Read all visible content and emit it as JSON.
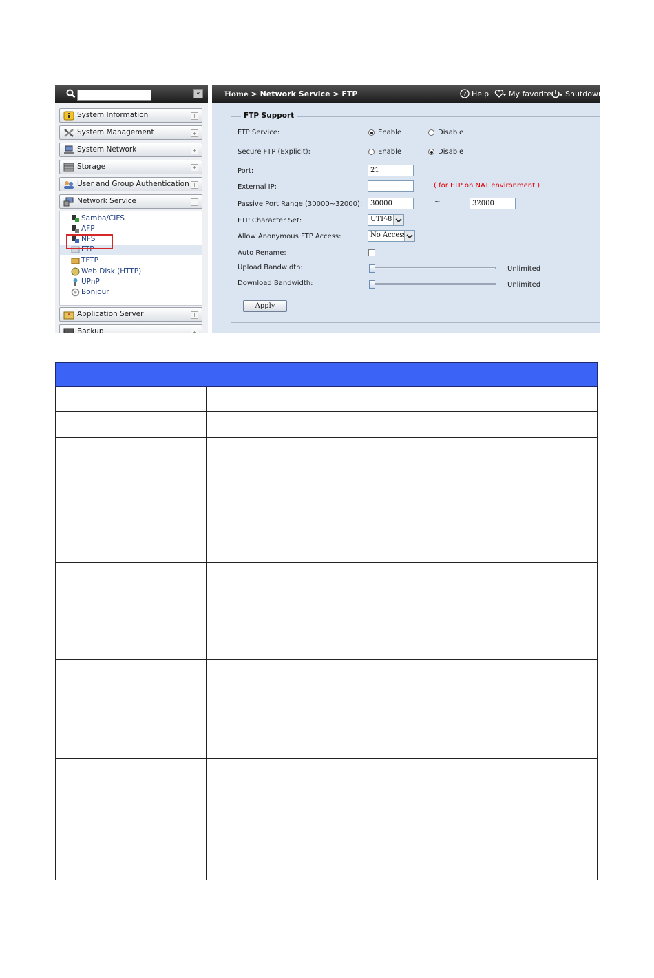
{
  "sidebar": {
    "search_placeholder": "",
    "collapse_symbol": "«",
    "categories": [
      {
        "label": "System Information"
      },
      {
        "label": "System Management"
      },
      {
        "label": "System Network"
      },
      {
        "label": "Storage"
      },
      {
        "label": "User and Group Authentication"
      },
      {
        "label": "Network Service"
      },
      {
        "label": "Application Server"
      },
      {
        "label": "Backup"
      }
    ],
    "network_items": [
      {
        "label": "Samba/CIFS"
      },
      {
        "label": "AFP"
      },
      {
        "label": "NFS"
      },
      {
        "label": "FTP"
      },
      {
        "label": "TFTP"
      },
      {
        "label": "Web Disk (HTTP)"
      },
      {
        "label": "UPnP"
      },
      {
        "label": "Bonjour"
      }
    ],
    "toggle_symbol": "+",
    "toggle_open_symbol": "−"
  },
  "topbar": {
    "crumb_home": "Home",
    "crumb_rest": " > Network Service > FTP",
    "help": "Help",
    "favorite": "My favorite",
    "shutdown": "Shutdown"
  },
  "form": {
    "legend": "FTP Support",
    "ftp_service": {
      "label": "FTP Service:",
      "enable": "Enable",
      "disable": "Disable",
      "selected": "enable"
    },
    "secure_ftp": {
      "label": "Secure FTP (Explicit):",
      "enable": "Enable",
      "disable": "Disable",
      "selected": "disable"
    },
    "port": {
      "label": "Port:",
      "value": "21"
    },
    "external_ip": {
      "label": "External IP:",
      "value": "",
      "hint": "( for FTP on NAT environment )"
    },
    "passive_range": {
      "label": "Passive Port Range (30000~32000):",
      "from": "30000",
      "sep": "~",
      "to": "32000"
    },
    "charset": {
      "label": "FTP Character Set:",
      "value": "UTF-8"
    },
    "anonymous": {
      "label": "Allow Anonymous FTP Access:",
      "value": "No Access"
    },
    "auto_rename": {
      "label": "Auto Rename:",
      "checked": false
    },
    "upload_bw": {
      "label": "Upload Bandwidth:",
      "value": "Unlimited"
    },
    "download_bw": {
      "label": "Download Bandwidth:",
      "value": "Unlimited"
    },
    "apply": "Apply"
  },
  "colors": {
    "highlight_box": "#d62828",
    "table_header": "#3b64f7",
    "hint_red": "#e00000"
  }
}
